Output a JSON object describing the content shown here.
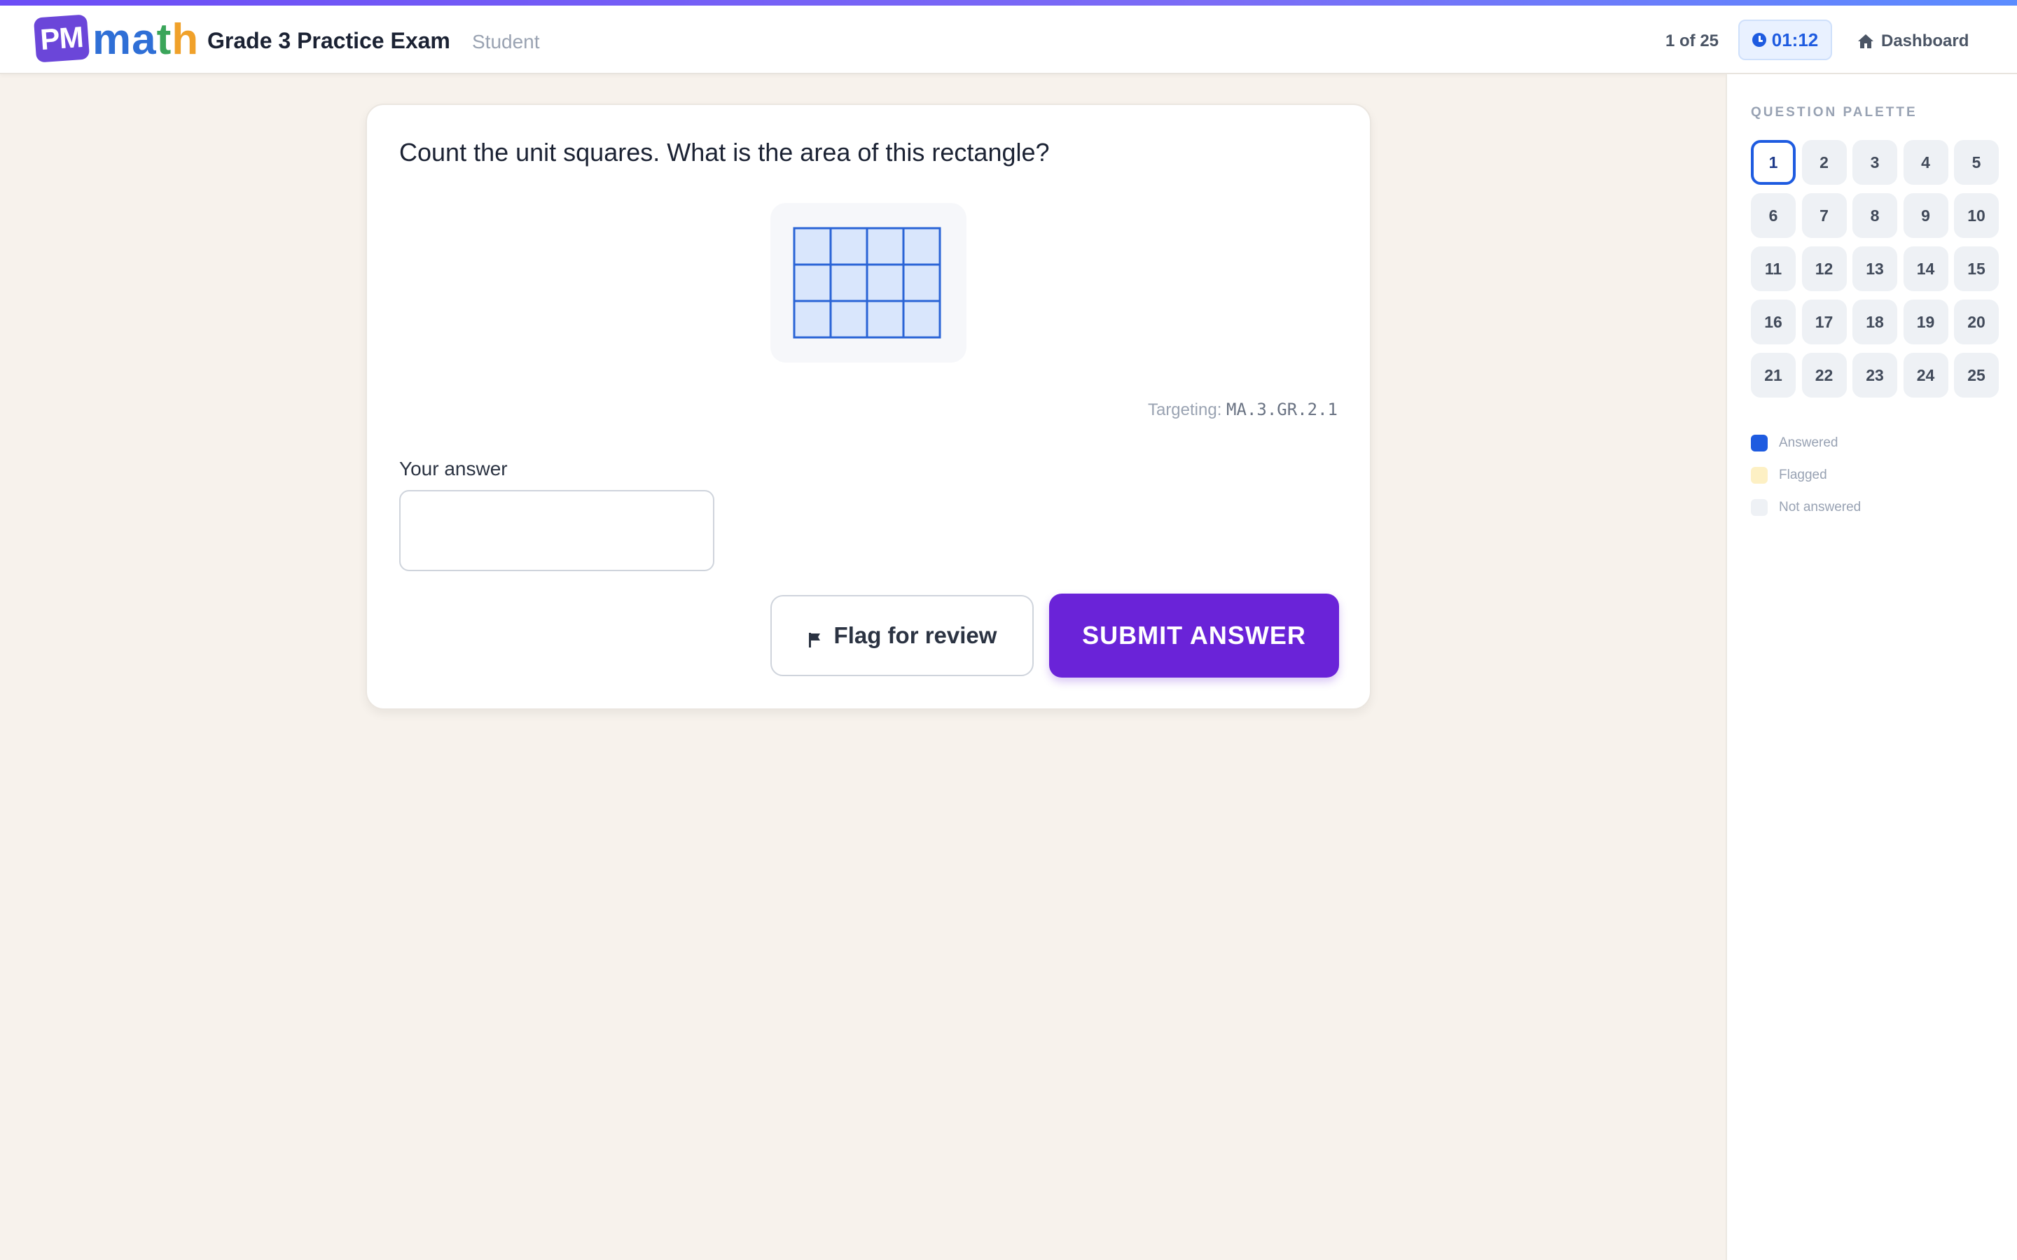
{
  "header": {
    "logo_badge": "PM",
    "logo_word": [
      "m",
      "a",
      "t",
      "h"
    ],
    "exam_title": "Grade 3 Practice Exam",
    "role": "Student",
    "progress": "1 of 25",
    "timer": "01:12",
    "dashboard_label": "Dashboard",
    "icons": {
      "timer": "clock-icon",
      "dashboard": "home-icon"
    }
  },
  "question": {
    "prompt": "Count the unit squares. What is the area of this rectangle?",
    "figure": {
      "rows": 3,
      "columns": 4
    },
    "targeting_label": "Targeting:",
    "targeting_code": "MA.3.GR.2.1",
    "answer_label": "Your answer",
    "answer_value": "",
    "answer_placeholder": "",
    "flag_label": "Flag for review",
    "submit_label": "SUBMIT ANSWER"
  },
  "palette": {
    "title": "QUESTION PALETTE",
    "current": 1,
    "questions": [
      "1",
      "2",
      "3",
      "4",
      "5",
      "6",
      "7",
      "8",
      "9",
      "10",
      "11",
      "12",
      "13",
      "14",
      "15",
      "16",
      "17",
      "18",
      "19",
      "20",
      "21",
      "22",
      "23",
      "24",
      "25"
    ],
    "legend": [
      {
        "label": "Answered",
        "color": "#1e5be0"
      },
      {
        "label": "Flagged",
        "color": "#fdf0c4"
      },
      {
        "label": "Not answered",
        "color": "#eef1f5"
      }
    ]
  },
  "colors": {
    "accent": "#6a23d8",
    "primary_blue": "#1e5be0",
    "background": "#f7f2ec"
  }
}
